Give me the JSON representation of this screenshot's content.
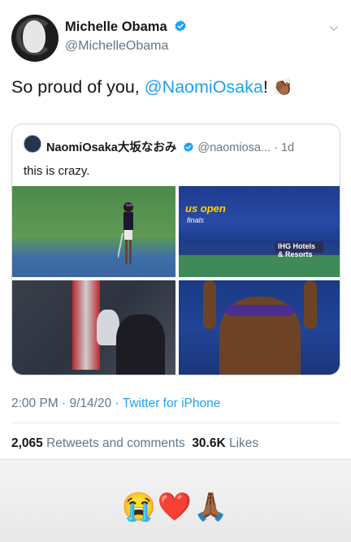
{
  "tweet": {
    "author_name": "Michelle Obama",
    "author_handle": "@MichelleObama",
    "text_prefix": "So proud of you, ",
    "mention": "@NaomiOsaka",
    "text_suffix": "! ",
    "clap_emoji": "👏🏾",
    "timestamp": "2:00 PM · 9/14/20 · ",
    "source": "Twitter for iPhone",
    "retweets_count": "2,065",
    "retweets_label": " Retweets and comments",
    "likes_count": "30.6K",
    "likes_label": " Likes"
  },
  "quoted_tweet": {
    "author_name": "NaomiOsaka大坂なおみ",
    "author_handle": "@naomiosa...",
    "time": " · 1d",
    "text": "this is crazy.",
    "photos": [
      {
        "logo": "",
        "logo_sub": "",
        "board": ""
      },
      {
        "logo": "us open",
        "logo_sub": "finals",
        "board": "IHG Hotels & Resorts"
      },
      {
        "logo": "",
        "logo_sub": "",
        "board": ""
      },
      {
        "logo": "",
        "logo_sub": "",
        "board": ""
      }
    ]
  },
  "story": {
    "reactions": "😭❤️🙏🏾"
  },
  "colors": {
    "accent": "#1da1f2",
    "text_primary": "#14171a",
    "text_secondary": "#657786"
  }
}
